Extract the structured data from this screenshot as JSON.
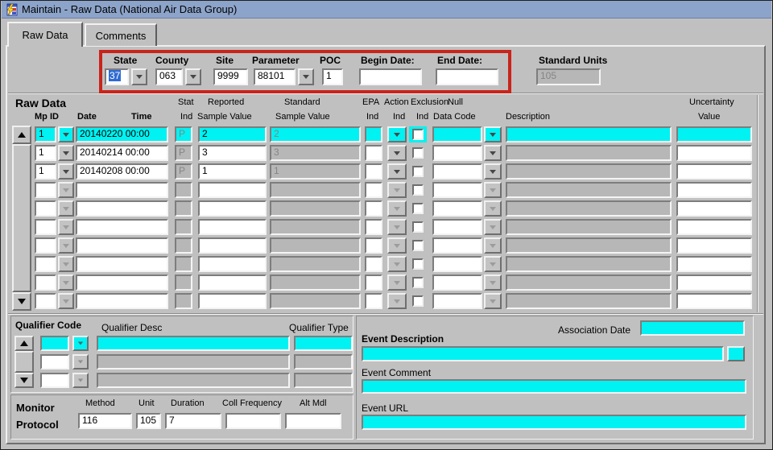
{
  "colors": {
    "highlight_cyan": "#00f2f2",
    "titlebar_blue": "#8da4ca",
    "annotation_red": "#c9241b",
    "selection_blue": "#2e6bd4",
    "panel_gray": "#c0c0c0",
    "disabled_gray": "#b7b7b7"
  },
  "window": {
    "title": "Maintain - Raw Data (National Air Data Group)"
  },
  "tabs": [
    {
      "label": "Raw Data",
      "active": true
    },
    {
      "label": "Comments",
      "active": false
    }
  ],
  "header": {
    "fields": [
      {
        "label": "State",
        "value": "37"
      },
      {
        "label": "County",
        "value": "063"
      },
      {
        "label": "Site",
        "value": "9999"
      },
      {
        "label": "Parameter",
        "value": "88101"
      },
      {
        "label": "POC",
        "value": "1"
      },
      {
        "label": "Begin Date:",
        "value": ""
      },
      {
        "label": "End Date:",
        "value": ""
      }
    ],
    "standard_units": {
      "label": "Standard Units",
      "value": "105"
    }
  },
  "raw_data": {
    "section_label": "Raw Data",
    "columns": {
      "mp_id": "Mp ID",
      "date": "Date",
      "time": "Time",
      "stat_l1": "Stat",
      "stat_l2": "Ind",
      "reported_l1": "Reported",
      "reported_l2": "Sample Value",
      "standard_l1": "Standard",
      "standard_l2": "Sample  Value",
      "epa_l1": "EPA",
      "epa_l2": "Ind",
      "action_l1": "Action",
      "action_l2": "Ind",
      "exclusion_l1": "Exclusion",
      "exclusion_l2": "Ind",
      "null_l1": "Null",
      "null_l2": "Data Code",
      "description": "Description",
      "uncertainty_l1": "Uncertainty",
      "uncertainty_l2": "Value"
    },
    "rows": [
      {
        "mp_id": "1",
        "datetime": "20140220 00:00",
        "stat_ind": "P",
        "reported": "2",
        "standard": "2",
        "epa_ind": "",
        "exclusion_checked": false,
        "null_code": "",
        "description": "",
        "uncertainty": "",
        "current": true
      },
      {
        "mp_id": "1",
        "datetime": "20140214 00:00",
        "stat_ind": "P",
        "reported": "3",
        "standard": "3",
        "epa_ind": "",
        "exclusion_checked": false,
        "null_code": "",
        "description": "",
        "uncertainty": "",
        "current": false
      },
      {
        "mp_id": "1",
        "datetime": "20140208 00:00",
        "stat_ind": "P",
        "reported": "1",
        "standard": "1",
        "epa_ind": "",
        "exclusion_checked": false,
        "null_code": "",
        "description": "",
        "uncertainty": "",
        "current": false
      },
      {
        "mp_id": "",
        "datetime": "",
        "stat_ind": "",
        "reported": "",
        "standard": "",
        "epa_ind": "",
        "exclusion_checked": false,
        "null_code": "",
        "description": "",
        "uncertainty": "",
        "current": false
      },
      {
        "mp_id": "",
        "datetime": "",
        "stat_ind": "",
        "reported": "",
        "standard": "",
        "epa_ind": "",
        "exclusion_checked": false,
        "null_code": "",
        "description": "",
        "uncertainty": "",
        "current": false
      },
      {
        "mp_id": "",
        "datetime": "",
        "stat_ind": "",
        "reported": "",
        "standard": "",
        "epa_ind": "",
        "exclusion_checked": false,
        "null_code": "",
        "description": "",
        "uncertainty": "",
        "current": false
      },
      {
        "mp_id": "",
        "datetime": "",
        "stat_ind": "",
        "reported": "",
        "standard": "",
        "epa_ind": "",
        "exclusion_checked": false,
        "null_code": "",
        "description": "",
        "uncertainty": "",
        "current": false
      },
      {
        "mp_id": "",
        "datetime": "",
        "stat_ind": "",
        "reported": "",
        "standard": "",
        "epa_ind": "",
        "exclusion_checked": false,
        "null_code": "",
        "description": "",
        "uncertainty": "",
        "current": false
      },
      {
        "mp_id": "",
        "datetime": "",
        "stat_ind": "",
        "reported": "",
        "standard": "",
        "epa_ind": "",
        "exclusion_checked": false,
        "null_code": "",
        "description": "",
        "uncertainty": "",
        "current": false
      },
      {
        "mp_id": "",
        "datetime": "",
        "stat_ind": "",
        "reported": "",
        "standard": "",
        "epa_ind": "",
        "exclusion_checked": false,
        "null_code": "",
        "description": "",
        "uncertainty": "",
        "current": false
      }
    ]
  },
  "qualifier": {
    "code_label": "Qualifier Code",
    "desc_label": "Qualifier Desc",
    "type_label": "Qualifier Type",
    "rows": [
      {
        "code": "",
        "desc": "",
        "type": "",
        "current": true
      },
      {
        "code": "",
        "desc": "",
        "type": "",
        "current": false
      },
      {
        "code": "",
        "desc": "",
        "type": "",
        "current": false
      }
    ]
  },
  "monitor_protocol": {
    "label_l1": "Monitor",
    "label_l2": "Protocol",
    "fields": [
      {
        "label": "Method",
        "value": "116"
      },
      {
        "label": "Unit",
        "value": "105"
      },
      {
        "label": "Duration",
        "value": "7"
      },
      {
        "label": "Coll Frequency",
        "value": ""
      },
      {
        "label": "Alt Mdl",
        "value": ""
      }
    ]
  },
  "event": {
    "association_date_label": "Association Date",
    "association_date_value": "",
    "description_label": "Event Description",
    "description_value": "",
    "comment_label": "Event Comment",
    "comment_value": "",
    "url_label": "Event URL",
    "url_value": ""
  }
}
